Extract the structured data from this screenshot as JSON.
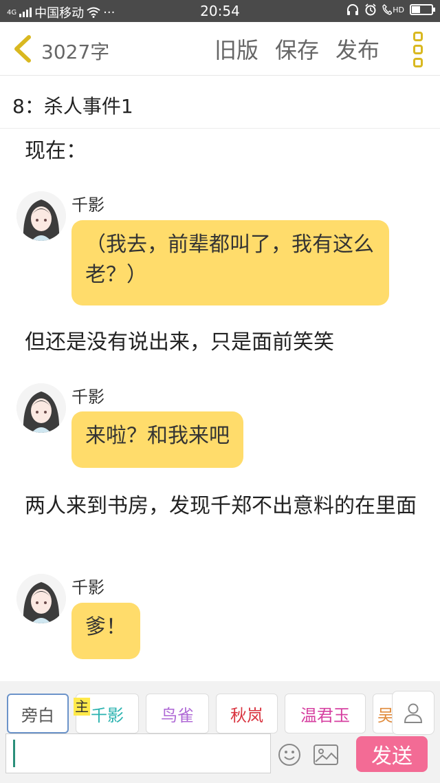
{
  "status_bar": {
    "network": "4G",
    "carrier": "中国移动",
    "more": "···",
    "time": "20:54",
    "hd": "HD"
  },
  "nav": {
    "word_count": "3027字",
    "old_version": "旧版",
    "save": "保存",
    "publish": "发布"
  },
  "chapter": {
    "title": "8：杀人事件1"
  },
  "content": [
    {
      "type": "narration",
      "text": "现在："
    },
    {
      "type": "dialogue",
      "speaker": "千影",
      "text": "（我去，前辈都叫了，我有这么老？）"
    },
    {
      "type": "narration",
      "text": "但还是没有说出来，只是面前笑笑"
    },
    {
      "type": "dialogue",
      "speaker": "千影",
      "text": "来啦？和我来吧"
    },
    {
      "type": "narration",
      "text": "两人来到书房，发现千郑不出意料的在里面"
    },
    {
      "type": "dialogue",
      "speaker": "千影",
      "text": "爹！"
    }
  ],
  "character_bar": {
    "protagonist_badge": "主",
    "chips": [
      {
        "label": "旁白",
        "color": "#555555"
      },
      {
        "label": "千影",
        "color": "#2bb3b0"
      },
      {
        "label": "鸟雀",
        "color": "#b06bd6"
      },
      {
        "label": "秋岚",
        "color": "#d9333f"
      },
      {
        "label": "温君玉",
        "color": "#d63fa0"
      },
      {
        "label": "吴",
        "color": "#e08a3a"
      }
    ]
  },
  "composer": {
    "input_value": "",
    "send_label": "发送"
  },
  "colors": {
    "bubble": "#ffdc6b",
    "send": "#f36b95",
    "accent_icon": "#d9b820"
  }
}
